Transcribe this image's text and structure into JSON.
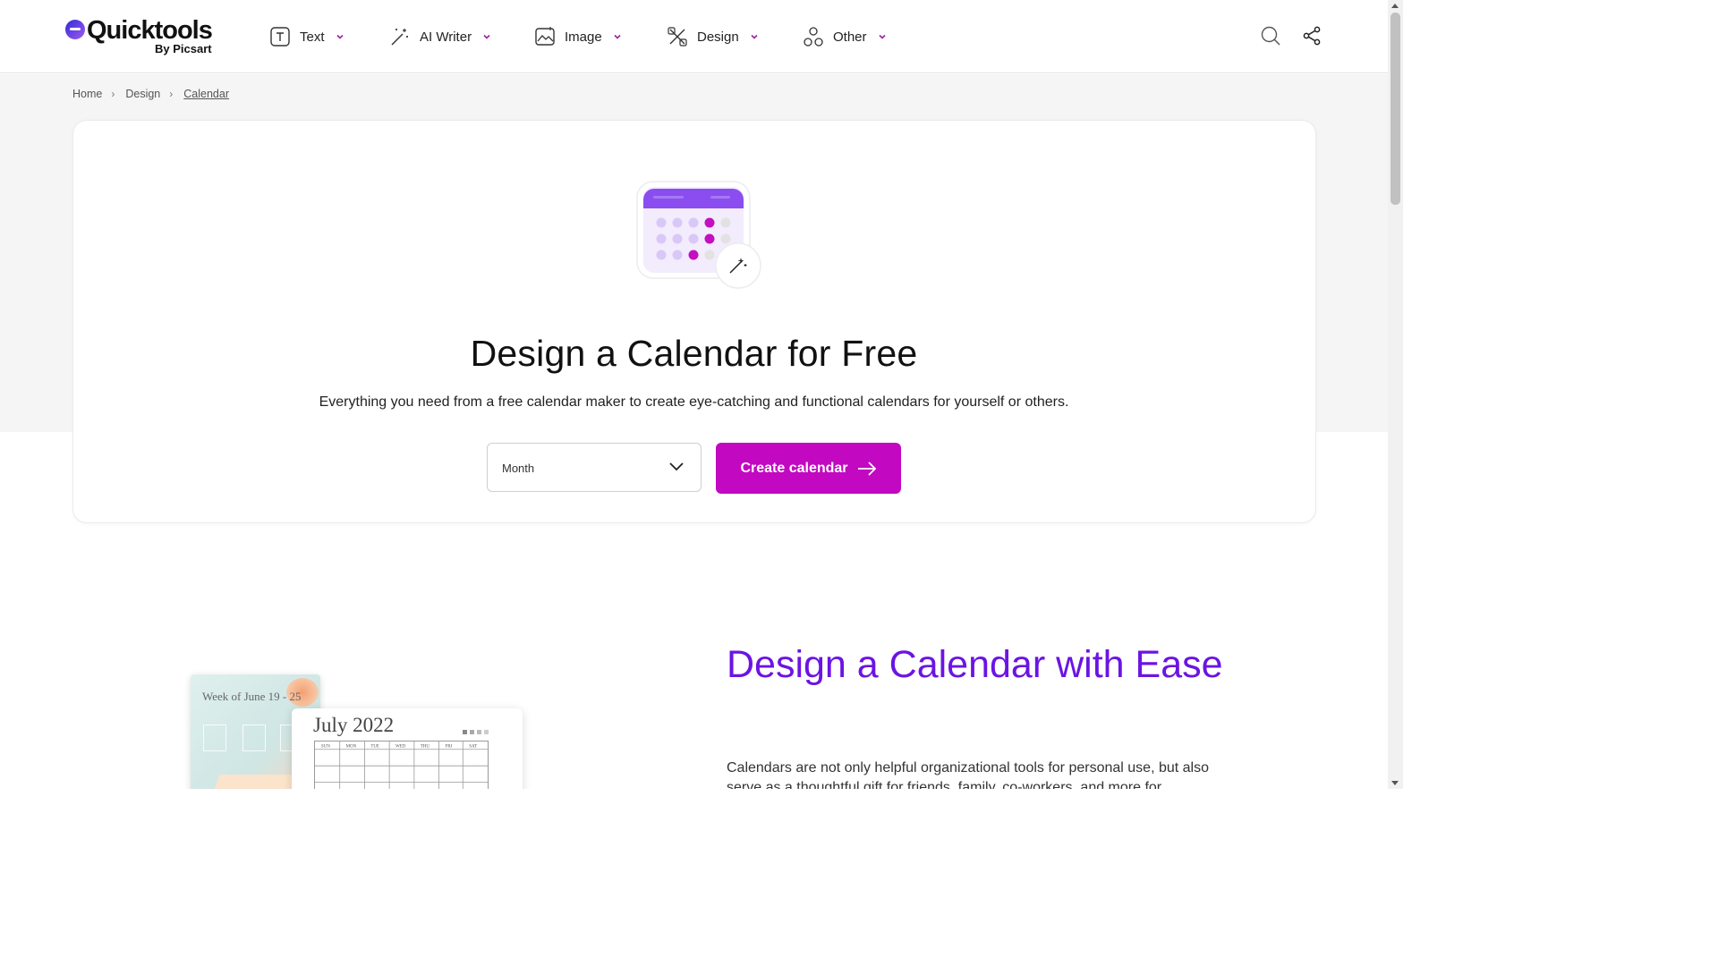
{
  "header": {
    "logo_main": "Quicktools",
    "logo_sub": "By Picsart",
    "nav": [
      {
        "label": "Text",
        "icon": "text-box-icon"
      },
      {
        "label": "AI Writer",
        "icon": "magic-wand-icon"
      },
      {
        "label": "Image",
        "icon": "image-icon"
      },
      {
        "label": "Design",
        "icon": "design-tools-icon"
      },
      {
        "label": "Other",
        "icon": "shapes-icon"
      }
    ],
    "search_icon": "search-icon",
    "share_icon": "share-icon"
  },
  "breadcrumb": [
    "Home",
    "Design",
    "Calendar"
  ],
  "hero": {
    "title": "Design a Calendar for Free",
    "subtitle": "Everything you need from a free calendar maker to create eye-catching and functional calendars for yourself or others.",
    "select_value": "Month",
    "cta_label": "Create calendar"
  },
  "section": {
    "title": "Design a Calendar with Ease",
    "paragraph": "Calendars are not only helpful organizational tools for personal use, but also serve as a thoughtful gift for friends, family, co-workers, and more for"
  },
  "previews": {
    "weekly_title": "Week of June 19 - 25",
    "monthly_title": "July 2022",
    "weekdays": [
      "SUN",
      "MON",
      "TUE",
      "WED",
      "THU",
      "FRI",
      "SAT"
    ]
  },
  "colors": {
    "accent": "#c209c1",
    "heading_purple": "#6b14e3",
    "calendar_header": "#8b4df0",
    "chevron": "#a01ea8"
  }
}
